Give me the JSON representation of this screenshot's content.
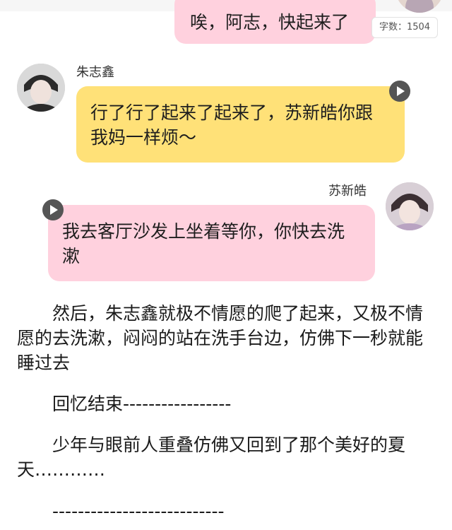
{
  "status": {
    "word_count": "字数：1504"
  },
  "messages": [
    {
      "sender": "",
      "text": "唉，阿志，快起来了",
      "color": "#ffd1de"
    },
    {
      "sender": "朱志鑫",
      "text": "行了行了起来了起来了，苏新皓你跟我妈一样烦～",
      "color": "#ffe178"
    },
    {
      "sender": "苏新皓",
      "text": "我去客厅沙发上坐着等你，你快去洗漱",
      "color": "#ffd1de"
    }
  ],
  "paragraphs": [
    "　　然后，朱志鑫就极不情愿的爬了起来，又极不情愿的去洗漱，闷闷的站在洗手台边，仿佛下一秒就能睡过去",
    "　　回忆结束-----------------",
    "　　少年与眼前人重叠仿佛又回到了那个美好的夏天…………",
    "　　---------------------------"
  ]
}
